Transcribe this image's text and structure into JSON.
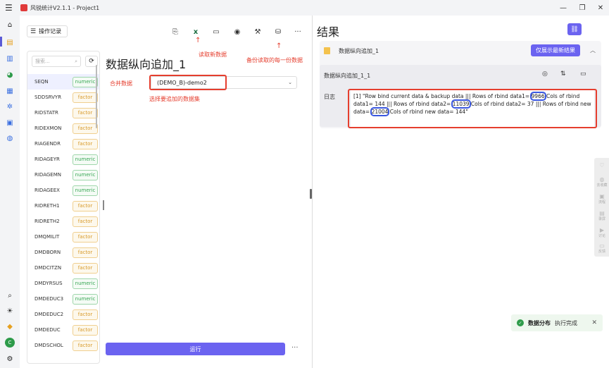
{
  "window": {
    "title": "风锐统计V2.1.1 - Project1",
    "controls": [
      "—",
      "❐",
      "✕"
    ]
  },
  "leftbar": {
    "icons": [
      "home-icon",
      "data-icon",
      "chart-icon",
      "pie-icon",
      "table-icon",
      "model-icon",
      "report-icon",
      "globe-icon"
    ],
    "bottom_icons": [
      "search-icon",
      "theme-icon",
      "vip-icon",
      "user-avatar",
      "settings-icon"
    ],
    "avatar_letter": "C"
  },
  "toolbar": {
    "ops_label": "操作记录"
  },
  "annotations": {
    "read_new": "读取新数据",
    "backup_each": "备份读取的每一份数据",
    "choose_dataset": "选择要追加的数据集"
  },
  "variables": {
    "search_placeholder": "搜索...",
    "items": [
      {
        "name": "SEQN",
        "type": "numeric"
      },
      {
        "name": "SDDSRVYR",
        "type": "factor"
      },
      {
        "name": "RIDSTATR",
        "type": "factor"
      },
      {
        "name": "RIDEXMON",
        "type": "factor"
      },
      {
        "name": "RIAGENDR",
        "type": "factor"
      },
      {
        "name": "RIDAGEYR",
        "type": "numeric"
      },
      {
        "name": "RIDAGEMN",
        "type": "numeric"
      },
      {
        "name": "RIDAGEEX",
        "type": "numeric"
      },
      {
        "name": "RIDRETH1",
        "type": "factor"
      },
      {
        "name": "RIDRETH2",
        "type": "factor"
      },
      {
        "name": "DMQMILIT",
        "type": "factor"
      },
      {
        "name": "DMDBORN",
        "type": "factor"
      },
      {
        "name": "DMDCITZN",
        "type": "factor"
      },
      {
        "name": "DMDYRSUS",
        "type": "numeric"
      },
      {
        "name": "DMDEDUC3",
        "type": "numeric"
      },
      {
        "name": "DMDEDUC2",
        "type": "factor"
      },
      {
        "name": "DMDEDUC",
        "type": "factor"
      },
      {
        "name": "DMDSCHOL",
        "type": "factor"
      }
    ]
  },
  "form": {
    "heading": "数据纵向追加_1",
    "merge_label": "合并数据",
    "merge_value": "(DEMO_B)-demo2",
    "run_label": "运行"
  },
  "result": {
    "title": "结果",
    "card_name": "数据纵向追加_1",
    "latest_only": "仅展示最新结果",
    "inner_title": "数据纵向追加_1_1",
    "log_label": "日志",
    "log_parts": {
      "p1": "[1] \"Row bind current data & backup data ||| Rows of rbind data1= ",
      "v1": "9966",
      "p2": " Cols of rbind data1= 144 ||| Rows of rbind data2= ",
      "v2": "11039",
      "p3": " Cols of rbind data2= 37 ||| Rows of rbind new data= ",
      "v3": "21004",
      "p4": " Cols of rbind new data= 144\""
    }
  },
  "toast": {
    "title": "数据分布",
    "message": "执行完成"
  },
  "floatbar": {
    "items": [
      "去收藏",
      "流程",
      "录屏",
      "讨论",
      "反馈"
    ]
  }
}
